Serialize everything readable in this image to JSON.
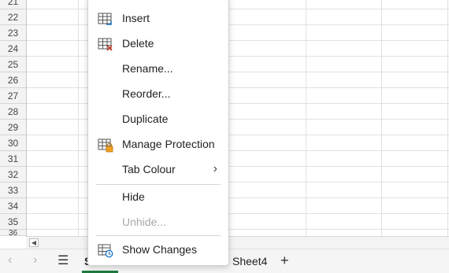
{
  "rows": [
    "21",
    "22",
    "23",
    "24",
    "25",
    "26",
    "27",
    "28",
    "29",
    "30",
    "31",
    "32",
    "33",
    "34",
    "35",
    "36"
  ],
  "context_menu": {
    "items": [
      {
        "label": "Insert",
        "icon": "insert-table-icon"
      },
      {
        "label": "Delete",
        "icon": "delete-table-icon"
      },
      {
        "label": "Rename...",
        "icon": ""
      },
      {
        "label": "Reorder...",
        "icon": ""
      },
      {
        "label": "Duplicate",
        "icon": ""
      },
      {
        "label": "Manage Protection",
        "icon": "protect-sheet-icon"
      },
      {
        "label": "Tab Colour",
        "icon": "",
        "submenu": true
      },
      {
        "label": "Hide",
        "icon": ""
      },
      {
        "label": "Unhide...",
        "icon": "",
        "disabled": true
      },
      {
        "label": "Show Changes",
        "icon": "show-changes-icon"
      }
    ]
  },
  "tabs": {
    "active_label": "S",
    "items": [
      "Sheet4"
    ]
  },
  "colors": {
    "highlight": "#ffff00",
    "active_tab_underline": "#1f7a3f"
  }
}
